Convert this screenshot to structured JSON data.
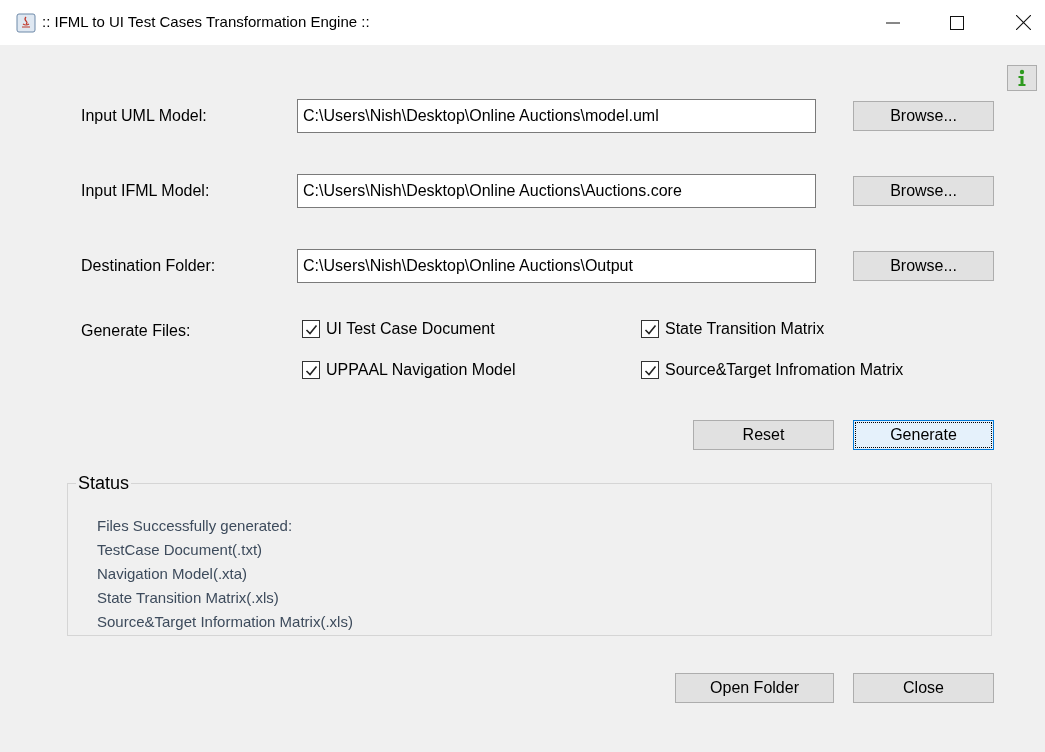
{
  "window": {
    "title": ":: IFML to UI Test Cases Transformation Engine ::"
  },
  "inputs": [
    {
      "label": "Input UML Model:",
      "value": "C:\\Users\\Nish\\Desktop\\Online Auctions\\model.uml",
      "button": "Browse..."
    },
    {
      "label": "Input IFML Model:",
      "value": "C:\\Users\\Nish\\Desktop\\Online Auctions\\Auctions.core",
      "button": "Browse..."
    },
    {
      "label": "Destination Folder:",
      "value": "C:\\Users\\Nish\\Desktop\\Online Auctions\\Output",
      "button": "Browse..."
    }
  ],
  "generate_files": {
    "label": "Generate Files:",
    "options": [
      {
        "label": "UI Test Case Document",
        "checked": true
      },
      {
        "label": "State Transition Matrix",
        "checked": true
      },
      {
        "label": "UPPAAL Navigation Model",
        "checked": true
      },
      {
        "label": "Source&Target Infromation Matrix",
        "checked": true
      }
    ]
  },
  "actions": [
    {
      "label": "Reset",
      "focused": false
    },
    {
      "label": "Generate",
      "focused": true
    }
  ],
  "status": {
    "title": "Status",
    "lines": [
      "Files Successfully generated:",
      "TestCase Document(.txt)",
      "Navigation Model(.xta)",
      "State Transition Matrix(.xls)",
      "Source&Target Information Matrix(.xls)"
    ]
  },
  "footer_buttons": [
    {
      "label": "Open Folder",
      "focused": false
    },
    {
      "label": "Close",
      "focused": false
    }
  ]
}
